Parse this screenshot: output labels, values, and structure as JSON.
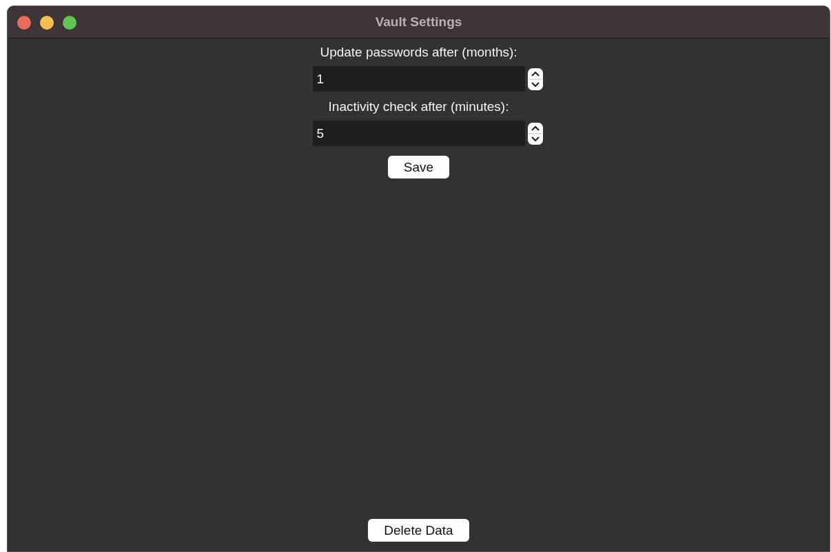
{
  "window": {
    "title": "Vault Settings"
  },
  "fields": [
    {
      "label": "Update passwords after (months):",
      "value": "1"
    },
    {
      "label": "Inactivity check after (minutes):",
      "value": "5"
    }
  ],
  "save_button": "Save",
  "delete_button": "Delete Data"
}
